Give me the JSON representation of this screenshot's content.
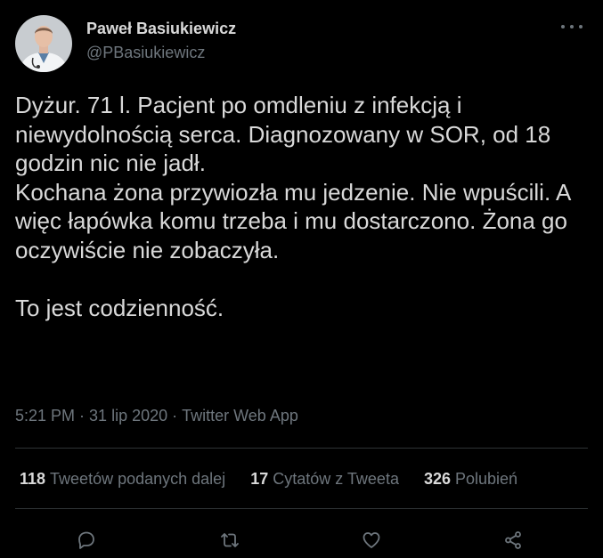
{
  "author": {
    "name": "Paweł Basiukiewicz",
    "handle": "@PBasiukiewicz"
  },
  "tweet": {
    "text": "Dyżur. 71 l.  Pacjent po omdleniu z infekcją i niewydolnością serca. Diagnozowany w SOR, od 18 godzin nic nie jadł.\nKochana żona przywiozła mu jedzenie. Nie wpuścili. A więc łapówka komu trzeba i mu dostarczono. Żona go oczywiście nie zobaczyła.\n\nTo jest codzienność."
  },
  "meta": {
    "time": "5:21 PM",
    "date": "31 lip 2020",
    "source": "Twitter Web App",
    "separator": "·"
  },
  "stats": {
    "retweets": {
      "count": "118",
      "label": "Tweetów podanych dalej"
    },
    "quotes": {
      "count": "17",
      "label": "Cytatów z Tweeta"
    },
    "likes": {
      "count": "326",
      "label": "Polubień"
    }
  },
  "actions": {
    "reply": "reply-icon",
    "retweet": "retweet-icon",
    "like": "heart-icon",
    "share": "share-icon"
  },
  "colors": {
    "background": "#000000",
    "text": "#d9d9d9",
    "secondary": "#6e767d",
    "divider": "#2f3336"
  }
}
